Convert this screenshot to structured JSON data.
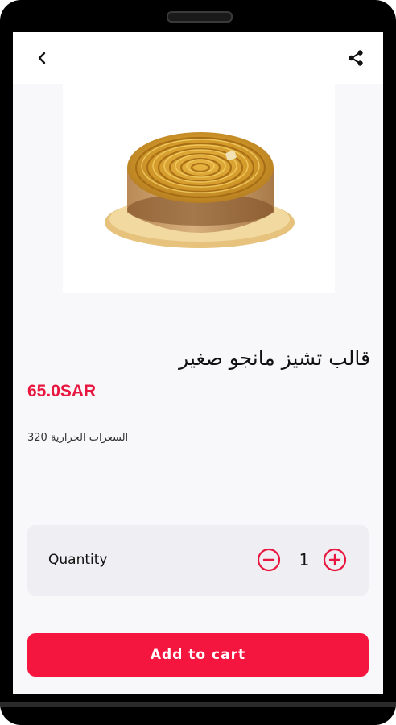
{
  "product": {
    "title": "قالب تشيز مانجو صغير",
    "price": "65.0SAR",
    "calories": "السعرات الحرارية 320",
    "image": "mango-cheesecake-tart"
  },
  "quantity": {
    "label": "Quantity",
    "value": "1"
  },
  "actions": {
    "add_to_cart": "Add to cart"
  },
  "icons": {
    "back": "back-icon",
    "share": "share-icon",
    "minus": "minus-circle-icon",
    "plus": "plus-circle-icon"
  },
  "colors": {
    "accent": "#f5163f",
    "price": "#e8173f",
    "screen_bg": "#f8f7f9",
    "card_bg": "#efeef2"
  }
}
